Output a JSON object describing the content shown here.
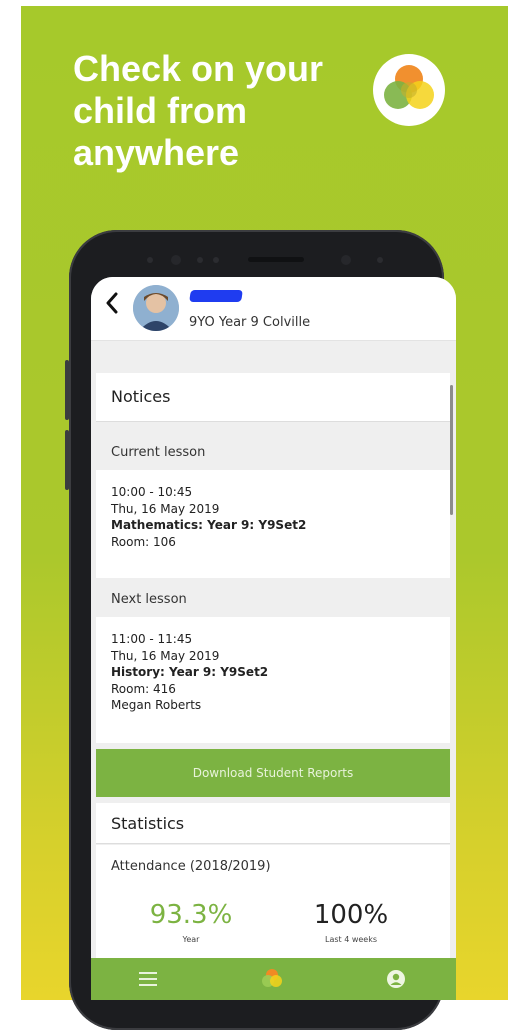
{
  "promo": {
    "headline_line1": "Check on your",
    "headline_line2": "child from",
    "headline_line3": "anywhere"
  },
  "student": {
    "info": "9YO  Year 9  Colville"
  },
  "notices": {
    "title": "Notices"
  },
  "current_lesson": {
    "label": "Current lesson",
    "time": "10:00 - 10:45",
    "date": "Thu, 16 May 2019",
    "subject": "Mathematics: Year 9: Y9Set2",
    "room": "Room: 106"
  },
  "next_lesson": {
    "label": "Next lesson",
    "time": "11:00 - 11:45",
    "date": "Thu, 16 May 2019",
    "subject": "History: Year 9: Y9Set2",
    "room": "Room: 416",
    "teacher": "Megan Roberts"
  },
  "download_button": "Download Student Reports",
  "statistics": {
    "title": "Statistics",
    "attendance_label": "Attendance (2018/2019)",
    "year_value": "93.3%",
    "year_caption": "Year",
    "recent_value": "100%",
    "recent_caption": "Last 4 weeks"
  },
  "colors": {
    "accent_green": "#7cb342",
    "attendance_green": "#7cb342",
    "redaction_blue": "#1f3cf0"
  },
  "icons": {
    "back": "chevron-left-icon",
    "menu": "hamburger-menu-icon",
    "home": "app-logo-icon",
    "profile": "user-circle-icon"
  }
}
